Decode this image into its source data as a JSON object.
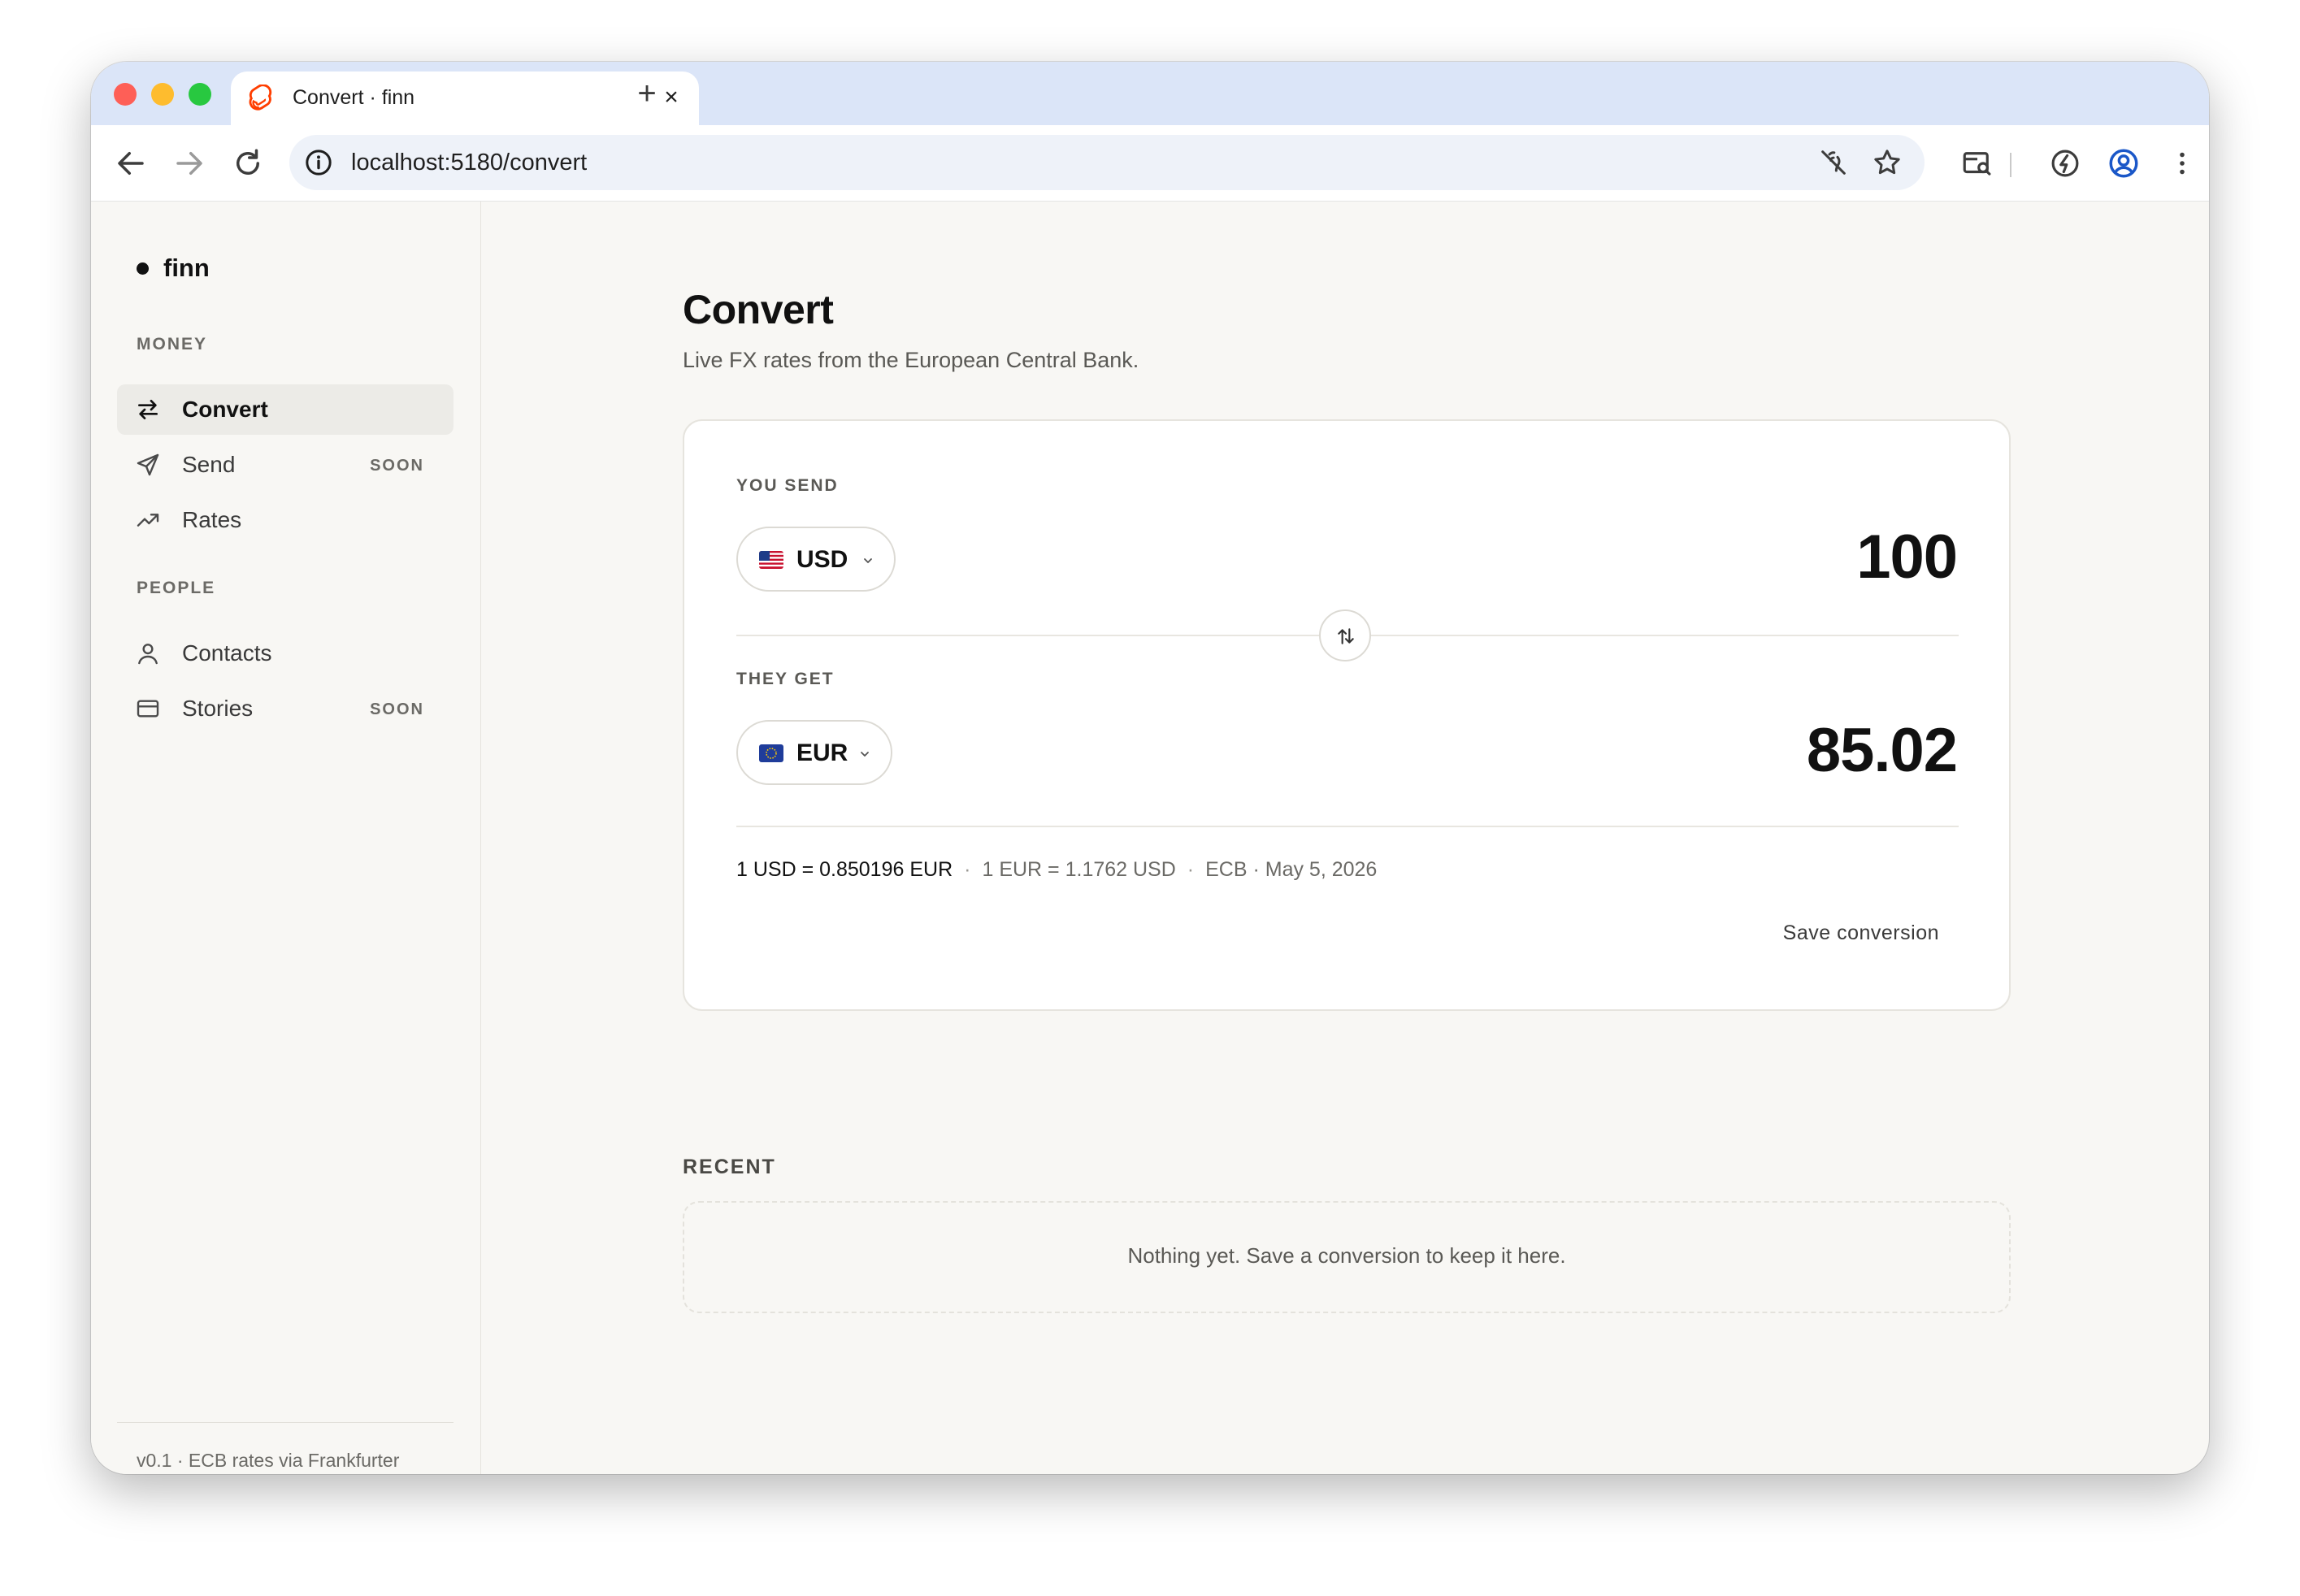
{
  "browser": {
    "tab_title": "Convert · finn",
    "url": "localhost:5180/convert"
  },
  "sidebar": {
    "brand": "finn",
    "sections": [
      {
        "label": "MONEY",
        "items": [
          {
            "label": "Convert",
            "icon": "swap-arrows-icon",
            "active": true
          },
          {
            "label": "Send",
            "icon": "paper-plane-icon",
            "badge": "SOON"
          },
          {
            "label": "Rates",
            "icon": "trending-up-icon"
          }
        ]
      },
      {
        "label": "PEOPLE",
        "items": [
          {
            "label": "Contacts",
            "icon": "person-icon"
          },
          {
            "label": "Stories",
            "icon": "card-icon",
            "badge": "SOON"
          }
        ]
      }
    ],
    "footer": "v0.1 · ECB rates via Frankfurter"
  },
  "main": {
    "title": "Convert",
    "subtitle": "Live FX rates from the European Central Bank.",
    "converter": {
      "send_label": "YOU SEND",
      "send_currency": "USD",
      "send_amount": "100",
      "get_label": "THEY GET",
      "get_currency": "EUR",
      "get_amount": "85.02",
      "rate_primary": "1 USD = 0.850196 EUR",
      "rate_inverse": "1 EUR = 1.1762 USD",
      "rate_source": "ECB · May 5, 2026",
      "save_label": "Save conversion"
    },
    "recent": {
      "label": "RECENT",
      "empty_text": "Nothing yet. Save a conversion to keep it here."
    }
  },
  "colors": {
    "page_bg": "#f8f7f4",
    "tabstrip_bg": "#dbe5f8",
    "accent_dark": "#111111",
    "active_nav_bg": "#ecebe7"
  }
}
